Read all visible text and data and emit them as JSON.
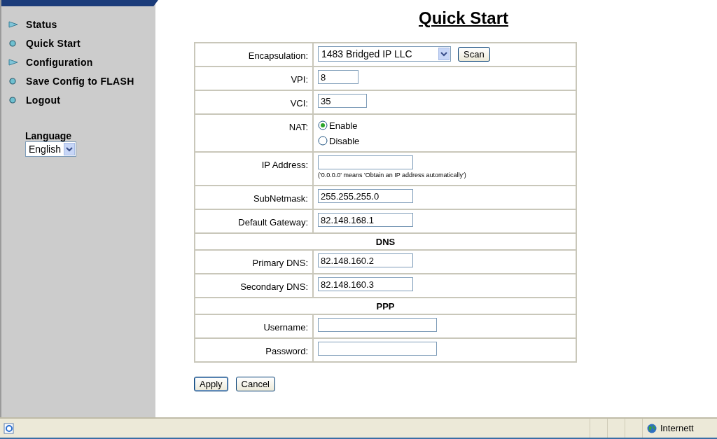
{
  "sidebar": {
    "items": [
      {
        "label": "Status",
        "kind": "submenu"
      },
      {
        "label": "Quick Start",
        "kind": "page"
      },
      {
        "label": "Configuration",
        "kind": "submenu"
      },
      {
        "label": "Save Config to FLASH",
        "kind": "page"
      },
      {
        "label": "Logout",
        "kind": "page"
      }
    ],
    "language": {
      "label": "Language",
      "value": "English"
    }
  },
  "page": {
    "title": "Quick Start"
  },
  "form": {
    "rows": [
      {
        "kind": "select",
        "label": "Encapsulation:",
        "value": "1483 Bridged IP LLC",
        "button": "Scan"
      },
      {
        "kind": "input",
        "label": "VPI:",
        "value": "8"
      },
      {
        "kind": "input",
        "label": "VCI:",
        "value": "35"
      },
      {
        "kind": "radio",
        "label": "NAT:",
        "options": [
          {
            "label": "Enable",
            "selected": true
          },
          {
            "label": "Disable",
            "selected": false
          }
        ]
      },
      {
        "kind": "input",
        "label": "IP Address:",
        "value": "",
        "hint": "('0.0.0.0' means 'Obtain an IP address automatically')"
      },
      {
        "kind": "input",
        "label": "SubNetmask:",
        "value": "255.255.255.0"
      },
      {
        "kind": "input",
        "label": "Default Gateway:",
        "value": "82.148.168.1"
      },
      {
        "kind": "header",
        "label": "DNS"
      },
      {
        "kind": "input",
        "label": "Primary DNS:",
        "value": "82.148.160.2"
      },
      {
        "kind": "input",
        "label": "Secondary DNS:",
        "value": "82.148.160.3"
      },
      {
        "kind": "header",
        "label": "PPP"
      },
      {
        "kind": "input",
        "label": "Username:",
        "value": ""
      },
      {
        "kind": "input",
        "label": "Password:",
        "value": ""
      }
    ],
    "buttons": [
      "Apply",
      "Cancel"
    ]
  },
  "status_bar": {
    "zone": "Internett"
  }
}
